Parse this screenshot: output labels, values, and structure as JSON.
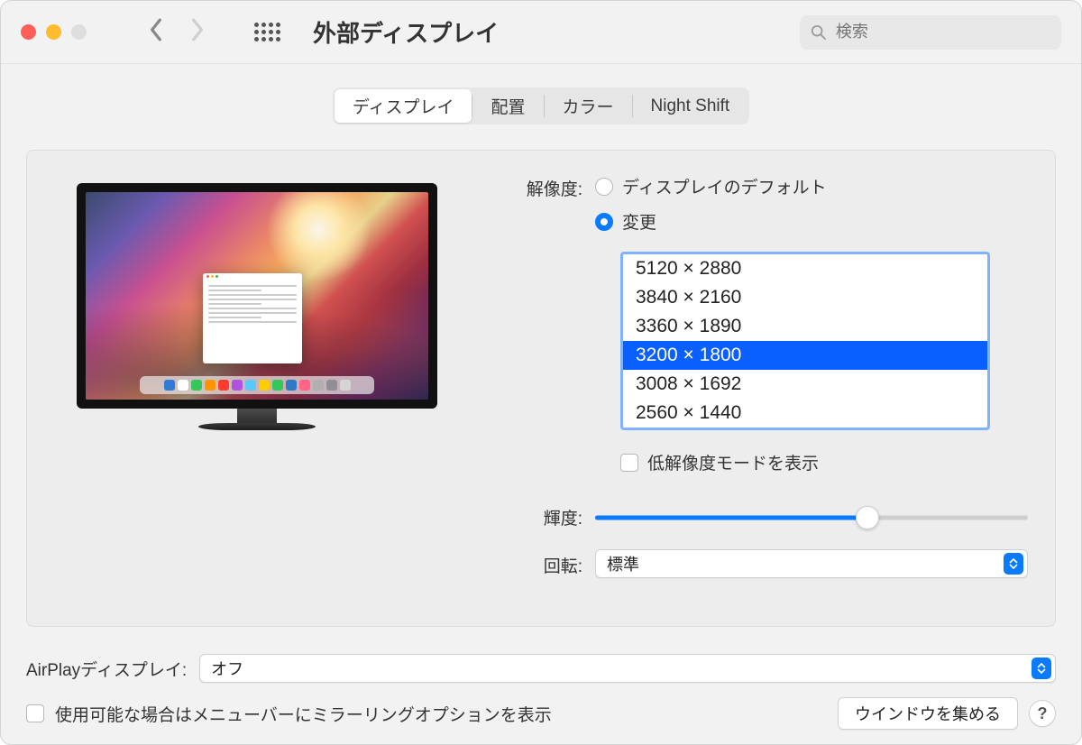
{
  "window": {
    "title": "外部ディスプレイ"
  },
  "search": {
    "placeholder": "検索"
  },
  "tabs": {
    "display": "ディスプレイ",
    "arrangement": "配置",
    "color": "カラー",
    "nightshift": "Night Shift"
  },
  "labels": {
    "resolution": "解像度:",
    "brightness": "輝度:",
    "rotation": "回転:",
    "airplay": "AirPlayディスプレイ:",
    "mirroring": "使用可能な場合はメニューバーにミラーリングオプションを表示",
    "gather": "ウインドウを集める",
    "help": "?"
  },
  "resolution": {
    "option_default": "ディスプレイのデフォルト",
    "option_scaled": "変更",
    "list": [
      "5120 × 2880",
      "3840 × 2160",
      "3360 × 1890",
      "3200 × 1800",
      "3008 × 1692",
      "2560 × 1440"
    ],
    "selected_index": 3,
    "low_res_label": "低解像度モードを表示"
  },
  "rotation": {
    "value": "標準"
  },
  "airplay": {
    "value": "オフ"
  },
  "dock_colors": [
    "#2f7bd6",
    "#ffffff",
    "#35c759",
    "#ff9500",
    "#ff3b30",
    "#af52de",
    "#5ac8fa",
    "#ffcc00",
    "#34c759",
    "#3178c6",
    "#ff6484",
    "#b0b0b0",
    "#8e8e93",
    "#d5d5d5"
  ]
}
